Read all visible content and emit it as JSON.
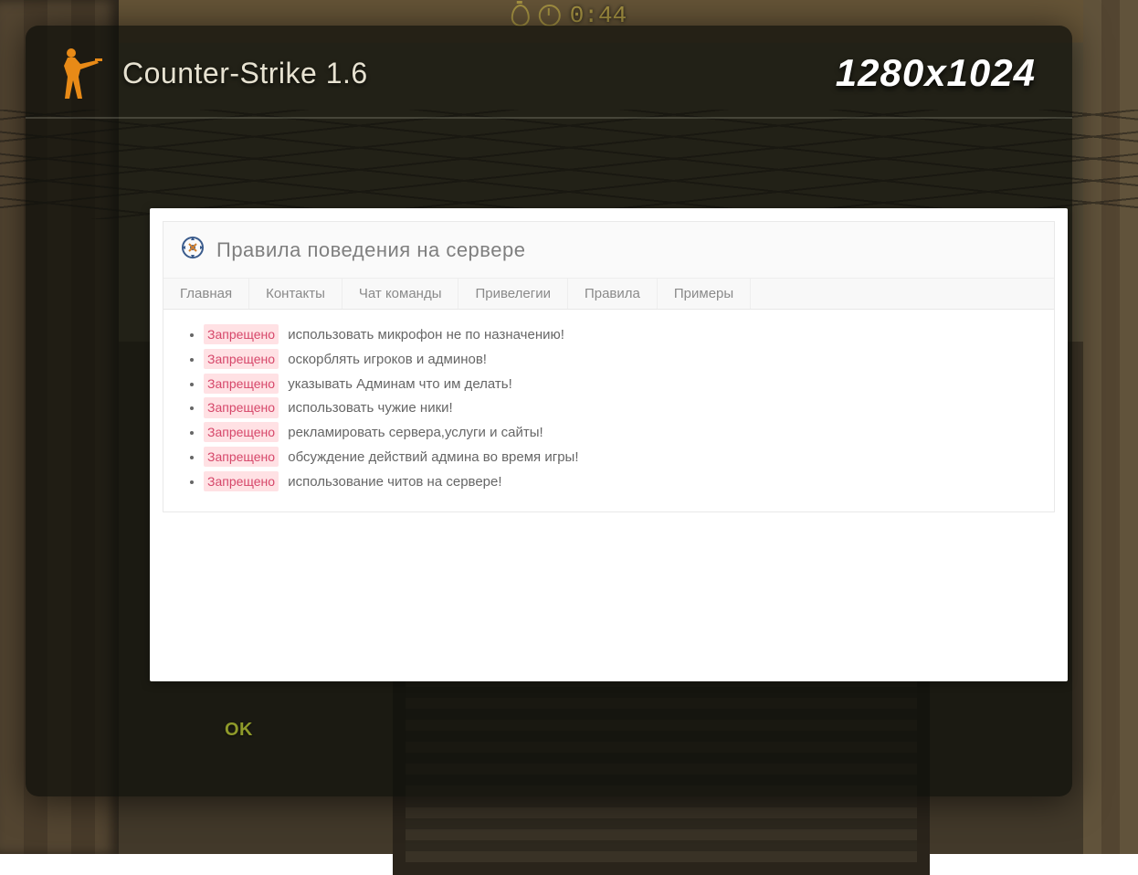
{
  "hud": {
    "timer": "0:44"
  },
  "overlay": {
    "title": "Counter-Strike 1.6",
    "resolution": "1280x1024",
    "ok_label": "OK"
  },
  "panel": {
    "title": "Правила поведения на сервере",
    "tabs": [
      "Главная",
      "Контакты",
      "Чат команды",
      "Привелегии",
      "Правила",
      "Примеры"
    ],
    "badge_label": "Запрещено",
    "rules": [
      "использовать микрофон не по назначению!",
      "оскорблять игроков и админов!",
      "указывать Админам что им делать!",
      "использовать чужие ники!",
      "рекламировать сервера,услуги и сайты!",
      "обсуждение действий админа во время игры!",
      "использование читов на сервере!"
    ]
  }
}
